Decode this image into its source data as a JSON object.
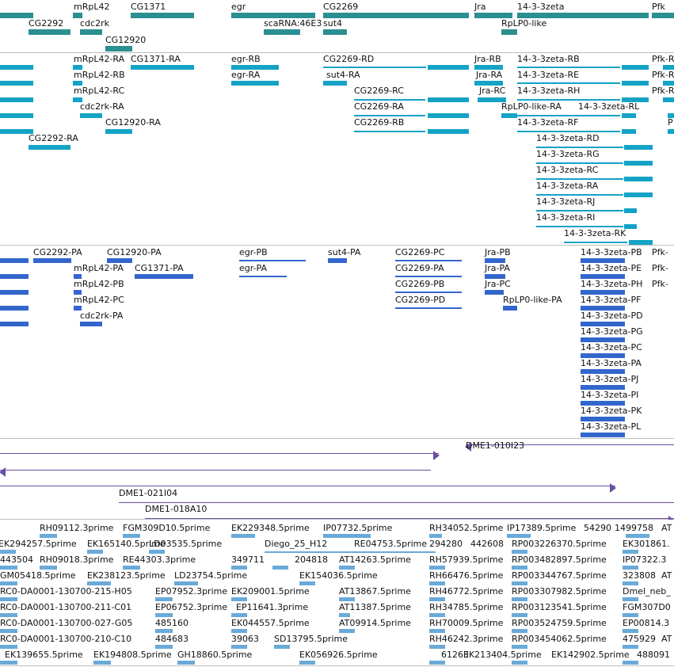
{
  "gene_track": {
    "labels": [
      "mRpL42",
      "CG1371",
      "egr",
      "CG2269",
      "Jra",
      "14-3-3zeta",
      "Pfk",
      "CG2292",
      "cdc2rk",
      "scaRNA:46E3",
      "sut4",
      "RpLP0-like",
      "CG12920"
    ]
  },
  "transcript_track": {
    "labels": [
      "mRpL42-RA",
      "CG1371-RA",
      "egr-RB",
      "CG2269-RD",
      "Jra-RB",
      "14-3-3zeta-RB",
      "Pfk-R",
      "mRpL42-RB",
      "egr-RA",
      "sut4-RA",
      "Jra-RA",
      "14-3-3zeta-RE",
      "Pfk-R",
      "mRpL42-RC",
      "CG2269-RC",
      "Jra-RC",
      "14-3-3zeta-RH",
      "Pfk-R",
      "cdc2rk-RA",
      "CG2269-RA",
      "RpLP0-like-RA",
      "14-3-3zeta-RL",
      "CG12920-RA",
      "CG2269-RB",
      "14-3-3zeta-RF",
      "P",
      "CG2292-RA",
      "14-3-3zeta-RD",
      "14-3-3zeta-RG",
      "14-3-3zeta-RC",
      "14-3-3zeta-RA",
      "14-3-3zeta-RJ",
      "14-3-3zeta-RI",
      "14-3-3zeta-RK"
    ]
  },
  "cds_track": {
    "labels": [
      "CG2292-PA",
      "CG12920-PA",
      "egr-PB",
      "sut4-PA",
      "CG2269-PC",
      "Jra-PB",
      "14-3-3zeta-PB",
      "Pfk-",
      "mRpL42-PA",
      "CG1371-PA",
      "egr-PA",
      "CG2269-PA",
      "Jra-PA",
      "14-3-3zeta-PE",
      "Pfk-",
      "mRpL42-PB",
      "CG2269-PB",
      "Jra-PC",
      "14-3-3zeta-PH",
      "Pfk-",
      "mRpL42-PC",
      "CG2269-PD",
      "RpLP0-like-PA",
      "14-3-3zeta-PF",
      "cdc2rk-PA",
      "14-3-3zeta-PD",
      "14-3-3zeta-PG",
      "14-3-3zeta-PC",
      "14-3-3zeta-PA",
      "14-3-3zeta-PJ",
      "14-3-3zeta-PI",
      "14-3-3zeta-PK",
      "14-3-3zeta-PL"
    ]
  },
  "clone_track": {
    "labels": [
      "DME1-010I23",
      "DME1-021I04",
      "DME1-018A10"
    ]
  },
  "est_track": {
    "labels": [
      "RH09112.3prime",
      "FGM309D10.5prime",
      "EK229348.5prime",
      "IP07732.5prime",
      "RH34052.5prime",
      "IP17389.5prime",
      "54290",
      "1499758",
      "AT",
      "EK294257.5prime",
      "EK165140.5prime",
      "LD03535.5prime",
      "Diego_25_H12",
      "RE04753.5prime",
      "294280",
      "442608",
      "RP003226370.5prime",
      "EK301861.",
      "443504",
      "RH09018.3prime",
      "RE44303.3prime",
      "349711",
      "204818",
      "AT14263.5prime",
      "RH57939.5prime",
      "RP003482897.5prime",
      "IP07322.3",
      "GM05418.5prime",
      "EK238123.5prime",
      "LD23754.5prime",
      "EK154036.5prime",
      "RH66476.5prime",
      "RP003344767.5prime",
      "323808",
      "AT",
      "RC0-DA0001-130700-215-H05",
      "EP07952.3prime",
      "EK209001.5prime",
      "AT13867.5prime",
      "RH46772.5prime",
      "RP003307982.5prime",
      "Dmel_neb_",
      "RC0-DA0001-130700-211-C01",
      "EP06752.3prime",
      "EP11641.3prime",
      "AT11387.5prime",
      "RH34785.5prime",
      "RP003123541.5prime",
      "FGM307D0",
      "RC0-DA0001-130700-027-G05",
      "485160",
      "EK044557.5prime",
      "AT09914.5prime",
      "RH70009.5prime",
      "RP003524759.5prime",
      "EP00814.3",
      "RC0-DA0001-130700-210-C10",
      "484683",
      "39063",
      "SD13795.5prime",
      "RH46242.3prime",
      "RP003454062.5prime",
      "475929",
      "AT",
      "EK139655.5prime",
      "EK194808.5prime",
      "GH18860.5prime",
      "EK056926.5prime",
      "61263",
      "EK213404.5prime",
      "EK142902.5prime",
      "488091"
    ]
  }
}
